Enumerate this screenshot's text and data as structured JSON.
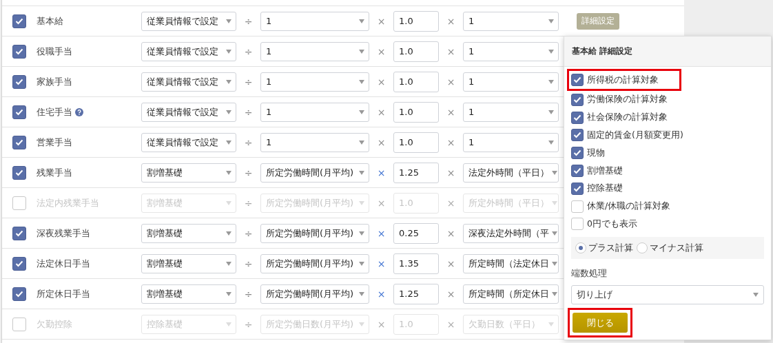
{
  "rows": [
    {
      "label": "基本給",
      "checked": true,
      "accent": false,
      "base": "従業員情報で設定",
      "divisor": "1",
      "rate": "1.0",
      "hours": "1",
      "detail_button": "詳細設定"
    },
    {
      "label": "役職手当",
      "checked": true,
      "accent": false,
      "base": "従業員情報で設定",
      "divisor": "1",
      "rate": "1.0",
      "hours": "1"
    },
    {
      "label": "家族手当",
      "checked": true,
      "accent": false,
      "base": "従業員情報で設定",
      "divisor": "1",
      "rate": "1.0",
      "hours": "1"
    },
    {
      "label": "住宅手当",
      "checked": true,
      "help": true,
      "accent": false,
      "base": "従業員情報で設定",
      "divisor": "1",
      "rate": "1.0",
      "hours": "1"
    },
    {
      "label": "営業手当",
      "checked": true,
      "accent": false,
      "base": "従業員情報で設定",
      "divisor": "1",
      "rate": "1.0",
      "hours": "1"
    },
    {
      "label": "残業手当",
      "checked": true,
      "accent": true,
      "base": "割増基礎",
      "divisor": "所定労働時間(月平均)",
      "rate": "1.25",
      "hours": "法定外時間（平日）"
    },
    {
      "label": "法定内残業手当",
      "checked": false,
      "accent": false,
      "base": "割増基礎",
      "divisor": "所定労働時間(月平均)",
      "rate": "1.0",
      "hours": "所定外時間（平日）"
    },
    {
      "label": "深夜残業手当",
      "checked": true,
      "accent": true,
      "base": "割増基礎",
      "divisor": "所定労働時間(月平均)",
      "rate": "0.25",
      "hours": "深夜法定外時間（平"
    },
    {
      "label": "法定休日手当",
      "checked": true,
      "accent": true,
      "base": "割増基礎",
      "divisor": "所定労働時間(月平均)",
      "rate": "1.35",
      "hours": "所定時間（法定休日"
    },
    {
      "label": "所定休日手当",
      "checked": true,
      "accent": true,
      "base": "割増基礎",
      "divisor": "所定労働時間(月平均)",
      "rate": "1.25",
      "hours": "所定時間（所定休日"
    },
    {
      "label": "欠勤控除",
      "checked": false,
      "accent": false,
      "base": "控除基礎",
      "divisor": "所定労働日数(月平均)",
      "rate": "1.0",
      "hours": "欠勤日数（平日）"
    }
  ],
  "operators": {
    "divide": "÷",
    "multiply": "×"
  },
  "popover": {
    "title": "基本給 詳細設定",
    "options": [
      {
        "label": "所得税の計算対象",
        "checked": true,
        "highlighted": true
      },
      {
        "label": "労働保険の計算対象",
        "checked": true,
        "highlighted": false
      },
      {
        "label": "社会保険の計算対象",
        "checked": true,
        "highlighted": false
      },
      {
        "label": "固定的賃金(月額変更用)",
        "checked": true,
        "highlighted": false
      },
      {
        "label": "現物",
        "checked": true,
        "highlighted": false
      },
      {
        "label": "割増基礎",
        "checked": true,
        "highlighted": false
      },
      {
        "label": "控除基礎",
        "checked": true,
        "highlighted": false
      },
      {
        "label": "休業/休職の計算対象",
        "checked": false,
        "highlighted": false
      },
      {
        "label": "0円でも表示",
        "checked": false,
        "highlighted": false
      }
    ],
    "radios": [
      {
        "label": "プラス計算",
        "selected": true
      },
      {
        "label": "マイナス計算",
        "selected": false
      }
    ],
    "rounding_label": "端数処理",
    "rounding_value": "切り上げ",
    "close_button": {
      "label": "閉じる",
      "highlighted": true
    }
  }
}
